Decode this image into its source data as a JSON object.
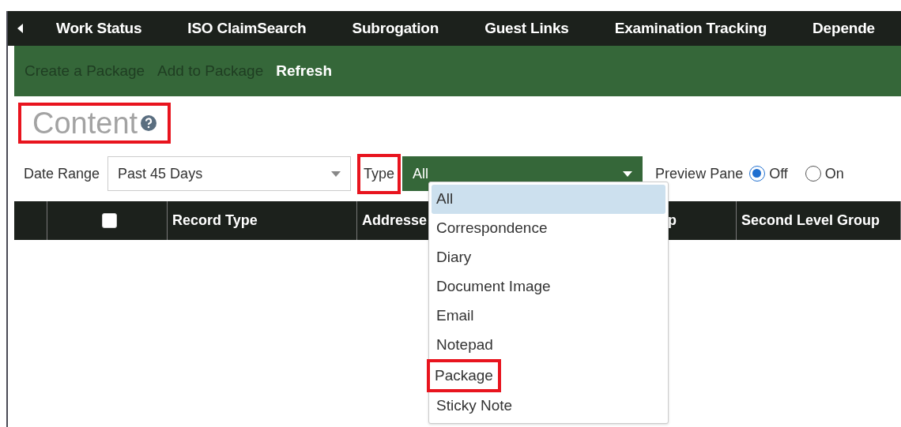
{
  "nav": {
    "items": [
      "Work Status",
      "ISO ClaimSearch",
      "Subrogation",
      "Guest Links",
      "Examination Tracking",
      "Depende"
    ]
  },
  "toolbar": [
    {
      "label": "Create a Package",
      "disabled": true
    },
    {
      "label": "Add to Package",
      "disabled": true
    },
    {
      "label": "Refresh",
      "disabled": false
    }
  ],
  "heading": {
    "title": "Content",
    "highlighted": true
  },
  "filters": {
    "date_range": {
      "label": "Date Range",
      "value": "Past 45 Days"
    },
    "type": {
      "label": "Type",
      "label_highlighted": true,
      "value": "All",
      "expanded": true
    },
    "preview_pane": {
      "label": "Preview Pane",
      "options": [
        {
          "label": "Off",
          "selected": true
        },
        {
          "label": "On",
          "selected": false
        }
      ]
    }
  },
  "table": {
    "header_checkbox": {
      "checked": false
    },
    "columns": [
      "Record Type",
      "Addresse",
      "p",
      "Second Level Group"
    ]
  },
  "type_options": [
    {
      "label": "All",
      "selected": true,
      "highlighted": false
    },
    {
      "label": "Correspondence",
      "selected": false,
      "highlighted": false
    },
    {
      "label": "Diary",
      "selected": false,
      "highlighted": false
    },
    {
      "label": "Document Image",
      "selected": false,
      "highlighted": false
    },
    {
      "label": "Email",
      "selected": false,
      "highlighted": false
    },
    {
      "label": "Notepad",
      "selected": false,
      "highlighted": false
    },
    {
      "label": "Package",
      "selected": false,
      "highlighted": true
    },
    {
      "label": "Sticky Note",
      "selected": false,
      "highlighted": false
    }
  ]
}
